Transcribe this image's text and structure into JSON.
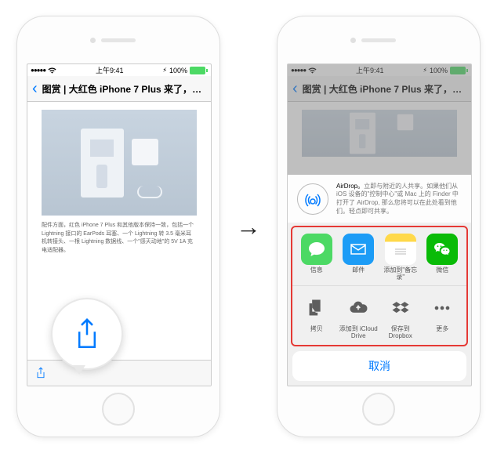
{
  "status": {
    "carrier": "●●●●●",
    "time": "上午9:41",
    "battery": "100%"
  },
  "nav": {
    "title": "图赏 | 大红色 iPhone 7 Plus 来了，你..."
  },
  "article": {
    "caption": "配件方面，红色 iPhone 7 Plus 和其他版本保持一致，包括一个 Lightning 接口的 EarPods 耳塞、一个 Lightning 转 3.5 毫米耳机转接头、一根 Lightning 数据线、一个\"感天动地\"的 5V 1A 充电适配器。"
  },
  "airdrop": {
    "title": "AirDrop。",
    "desc": "立即与附近的人共享。如果他们从 iOS 设备的\"控制中心\"或 Mac 上的 Finder 中打开了 AirDrop, 那么您将可以在此处看到他们。轻点即可共享。"
  },
  "apps": {
    "row1": [
      {
        "label": "信息",
        "bg": "#4cd964",
        "icon": "message"
      },
      {
        "label": "邮件",
        "bg": "#1c9cf6",
        "icon": "mail"
      },
      {
        "label": "添加到\"备忘录\"",
        "bg": "#ffcc00",
        "icon": "notes"
      },
      {
        "label": "微信",
        "bg": "#09bb07",
        "icon": "wechat"
      }
    ],
    "row2": [
      {
        "label": "拷贝",
        "icon": "copy"
      },
      {
        "label": "添加到 iCloud Drive",
        "icon": "icloud"
      },
      {
        "label": "保存到 Dropbox",
        "icon": "dropbox"
      },
      {
        "label": "更多",
        "icon": "more"
      }
    ]
  },
  "cancel": "取消"
}
